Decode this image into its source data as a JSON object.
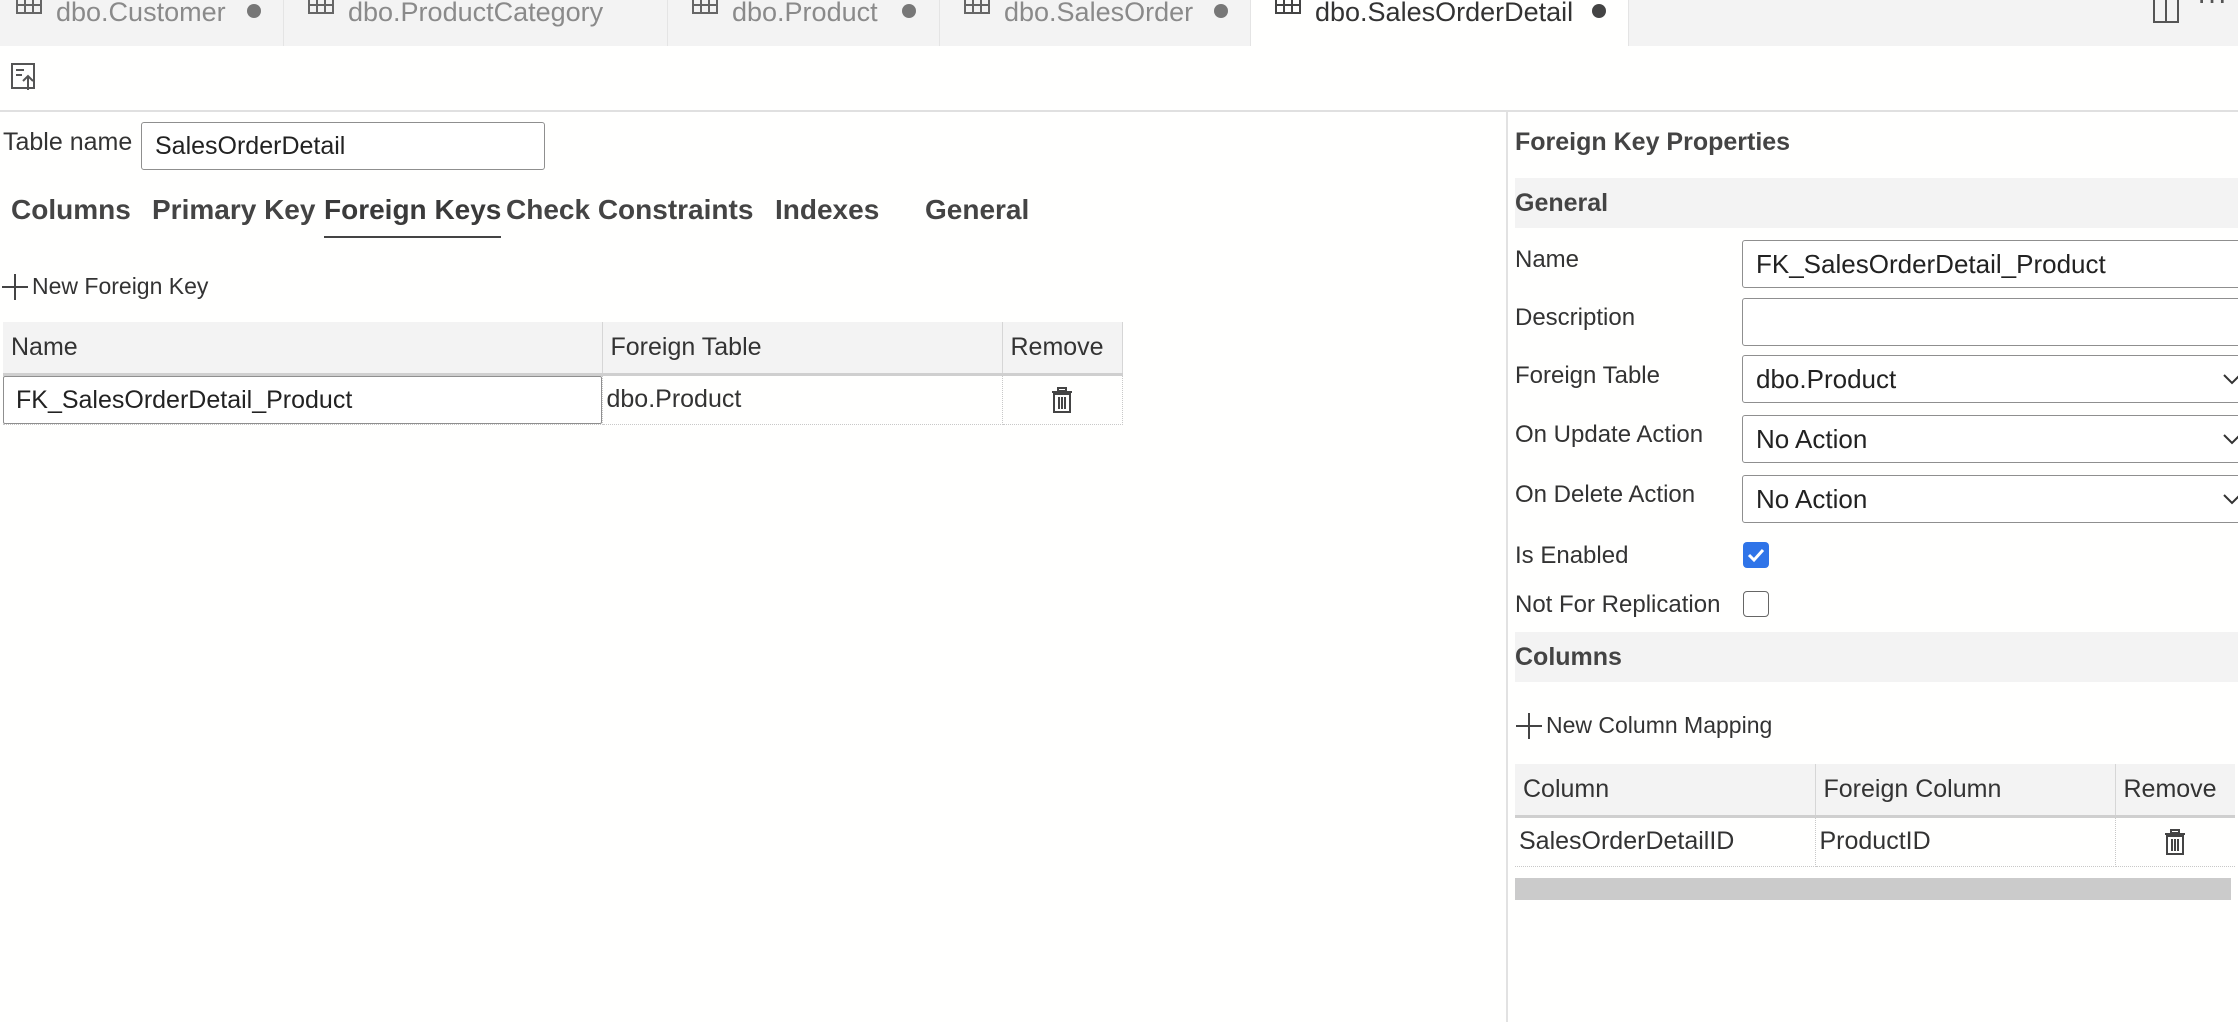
{
  "tabs": [
    {
      "label": "dbo.Customer",
      "icon": "table-icon",
      "modified": true
    },
    {
      "label": "dbo.ProductCategory",
      "icon": "table-icon",
      "modified": false
    },
    {
      "label": "dbo.Product",
      "icon": "table-icon",
      "modified": true
    },
    {
      "label": "dbo.SalesOrder",
      "icon": "table-icon",
      "modified": true
    },
    {
      "label": "dbo.SalesOrderDetail",
      "icon": "table-icon",
      "modified": true,
      "active": true
    }
  ],
  "tabbar_actions": {
    "more": "···"
  },
  "designer": {
    "table_name_label": "Table name",
    "table_name_value": "SalesOrderDetail",
    "tabs": [
      "Columns",
      "Primary Key",
      "Foreign Keys",
      "Check Constraints",
      "Indexes",
      "General"
    ],
    "active_tab": "Foreign Keys",
    "new_foreign_key_label": "New Foreign Key",
    "fk_table": {
      "headers": [
        "Name",
        "Foreign Table",
        "Remove"
      ],
      "rows": [
        {
          "name": "FK_SalesOrderDetail_Product",
          "foreign_table": "dbo.Product"
        }
      ]
    }
  },
  "properties": {
    "title": "Foreign Key Properties",
    "general_section": "General",
    "name_label": "Name",
    "name_value": "FK_SalesOrderDetail_Product",
    "description_label": "Description",
    "description_value": "",
    "foreign_table_label": "Foreign Table",
    "foreign_table_value": "dbo.Product",
    "on_update_label": "On Update Action",
    "on_update_value": "No Action",
    "on_delete_label": "On Delete Action",
    "on_delete_value": "No Action",
    "is_enabled_label": "Is Enabled",
    "is_enabled": true,
    "not_for_replication_label": "Not For Replication",
    "not_for_replication": false,
    "columns_section": "Columns",
    "new_column_mapping_label": "New Column Mapping",
    "mapping_table": {
      "headers": [
        "Column",
        "Foreign Column",
        "Remove"
      ],
      "rows": [
        {
          "column": "SalesOrderDetailID",
          "foreign_column": "ProductID"
        }
      ]
    }
  },
  "colors": {
    "accent": "#2f74e8",
    "tabbar_bg": "#f3f3f3"
  }
}
